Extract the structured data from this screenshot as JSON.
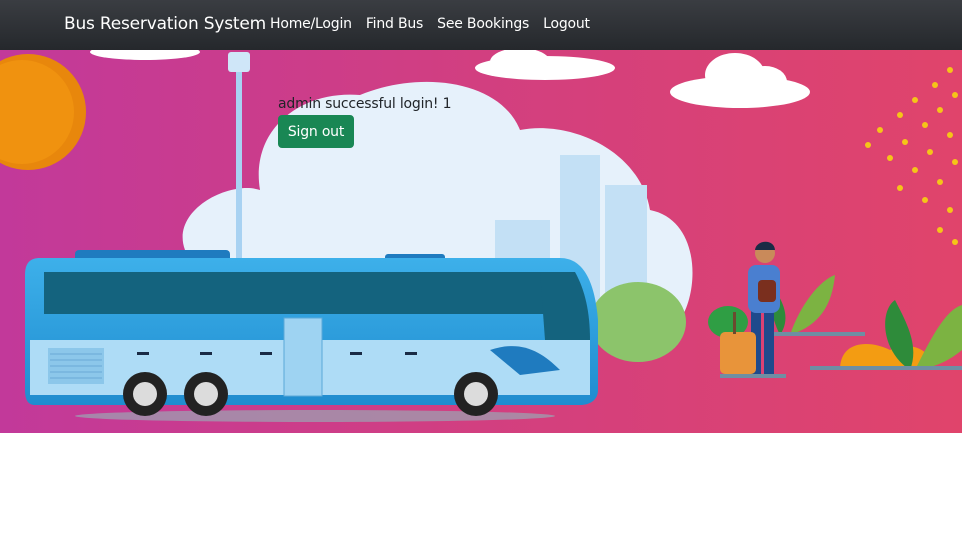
{
  "navbar": {
    "brand": "Bus Reservation System",
    "links": [
      "Home/Login",
      "Find Bus",
      "See Bookings",
      "Logout"
    ]
  },
  "main": {
    "message": "admin successful login! 1",
    "signout_label": "Sign out"
  },
  "colors": {
    "navbar_bg": "#2f3237",
    "hero_bg": "#d4407a",
    "button_bg": "#198754",
    "bus_blue": "#2d9ddb"
  },
  "hero_image": {
    "icons": [
      "bus-icon",
      "sun-icon",
      "cloud-icon",
      "city-icon",
      "traveler-icon",
      "plant-icon",
      "street-lamp-icon"
    ]
  }
}
